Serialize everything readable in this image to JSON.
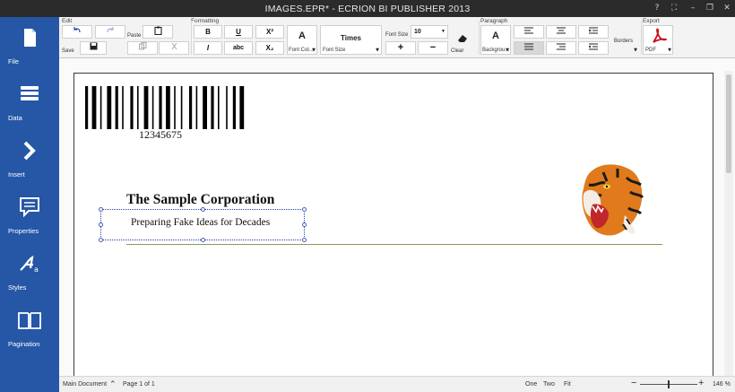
{
  "window": {
    "title": "IMAGES.EPR* - ECRION BI PUBLISHER 2013",
    "help": "?",
    "options": "⛶",
    "minimize": "–",
    "restore": "❐",
    "close": "✕"
  },
  "sidebar": {
    "items": [
      {
        "label": "File",
        "icon": "file-icon"
      },
      {
        "label": "Data",
        "icon": "database-icon"
      },
      {
        "label": "Insert",
        "icon": "chevron-right-icon"
      },
      {
        "label": "Properties",
        "icon": "comment-icon"
      },
      {
        "label": "Styles",
        "icon": "styles-icon"
      },
      {
        "label": "Pagination",
        "icon": "book-pages-icon"
      }
    ]
  },
  "ribbon": {
    "groups": {
      "edit": "Edit",
      "formatting": "Formatting",
      "paragraph": "Paragraph",
      "export": "Export"
    },
    "edit": {
      "save": "Save",
      "paste": "Paste"
    },
    "formatting": {
      "bold": "B",
      "italic": "I",
      "underline": "U",
      "strikethrough": "abc",
      "superscript": "X²",
      "subscript": "X₂",
      "font_color_glyph": "A",
      "font_color_label": "Font Col...",
      "font_name": "Times",
      "font_name_label": "Font Size",
      "font_size_label": "Font Size",
      "font_size_value": "10",
      "increase": "+",
      "decrease": "−",
      "clear": "Clear",
      "background_glyph": "A",
      "background_label": "Backgrou..."
    },
    "paragraph": {
      "borders": "Borders"
    },
    "export": {
      "format": "PDF"
    }
  },
  "document": {
    "barcode_number": "12345675",
    "company": "The Sample Corporation",
    "tagline": "Preparing Fake Ideas for Decades"
  },
  "statusbar": {
    "document": "Main Document",
    "page": "Page 1 of 1",
    "view_one": "One",
    "view_two": "Two",
    "view_fit": "Fit",
    "zoom_out": "−",
    "zoom_in": "+",
    "zoom": "146 %"
  },
  "colors": {
    "sidebar": "#2557a6",
    "titlebar": "#2b2b2b",
    "pdf_red": "#c8101a"
  }
}
